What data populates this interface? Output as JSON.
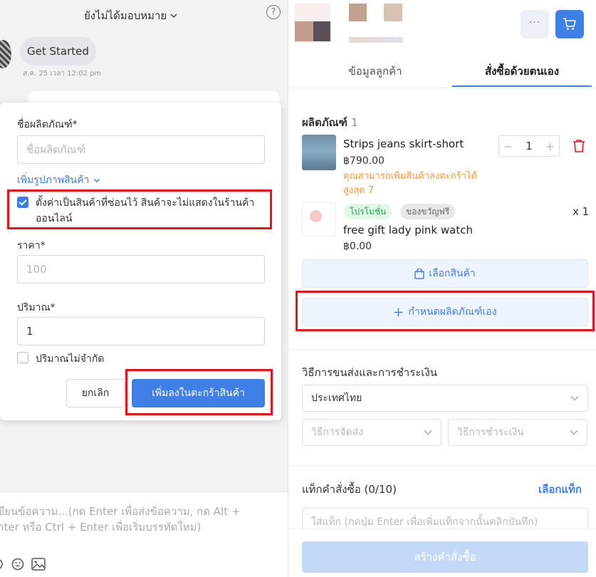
{
  "chat": {
    "assign_label": "ยังไม่ได้มอบหมาย",
    "help_symbol": "?",
    "message": {
      "text": "Get Started",
      "time": "ส.ค. 25 เวลา 12:02 pm"
    },
    "compose_placeholder": "เขียนข้อความ...(กด Enter เพื่อส่งข้อความ, กด Alt + Enter หรือ Ctrl + Enter เพื่อเริ่มบรรทัดใหม่)",
    "compose_line1": "ขียนข้อความ...(กด Enter เพื่อส่งข้อความ, กด Alt +",
    "compose_line2": "nter หรือ Ctrl + Enter เพื่อเริ่มบรรทัดใหม่)"
  },
  "popup": {
    "product_name_label": "ชื่อผลิตภัณฑ์*",
    "product_name_placeholder": "ชื่อผลิตภัณฑ์",
    "add_image_label": "เพิ่มรูปภาพสินค้า",
    "hidden_checkbox_label": "ตั้งค่าเป็นสินค้าที่ซ่อนไว้ สินค้าจะไม่แสดงในร้านค้าออนไลน์",
    "hidden_checked": true,
    "price_label": "ราคา*",
    "price_placeholder": "100",
    "quantity_label": "ปริมาณ*",
    "quantity_value": "1",
    "unlimited_label": "ปริมาณไม่จำกัด",
    "unlimited_checked": false,
    "cancel_label": "ยกเลิก",
    "add_to_cart_label": "เพิ่มลงในตะกร้าสินค้า"
  },
  "order": {
    "more_label": "···",
    "tabs": [
      {
        "label": "ข้อมูลลูกค้า",
        "active": false
      },
      {
        "label": "สั่งซื้อด้วยตนเอง",
        "active": true
      }
    ],
    "products_title": "ผลิตภัณฑ์",
    "products_count": "1",
    "items": [
      {
        "name": "Strips jeans skirt-short",
        "price": "฿790.00",
        "quantity": "1",
        "warning": "คุณสามารถเพิ่มสินค้าลงตะกร้าได้สูงสุด 7"
      },
      {
        "badge_promo": "โปรโมชั่น",
        "badge_gift": "ของขวัญฟรี",
        "quantity_label": "x 1",
        "name": "free gift lady pink watch",
        "price": "฿0.00"
      }
    ],
    "select_product_label": "เลือกสินค้า",
    "custom_product_label": "กำหนดผลิตภัณฑ์เอง",
    "shipping_title": "วิธีการขนส่งและการชำระเงิน",
    "country_value": "ประเทศไทย",
    "shipping_method_placeholder": "วิธีการจัดส่ง",
    "payment_method_placeholder": "วิธีการชำระเงิน",
    "tags_title": "แท็กคำสั่งซื้อ (0/10)",
    "select_tag_label": "เลือกแท็ก",
    "tag_input_placeholder": "ใส่แท็ก (กดปุ่ม Enter เพื่อเพิ่มแท็กจากนั้นคลิกบันทึก)",
    "create_order_label": "สร้างคำสั่งซื้อ"
  },
  "colors": {
    "accent": "#3f80e6",
    "highlight": "#e2161b",
    "warning": "#f39a3d",
    "promo_badge": "#26a556"
  }
}
